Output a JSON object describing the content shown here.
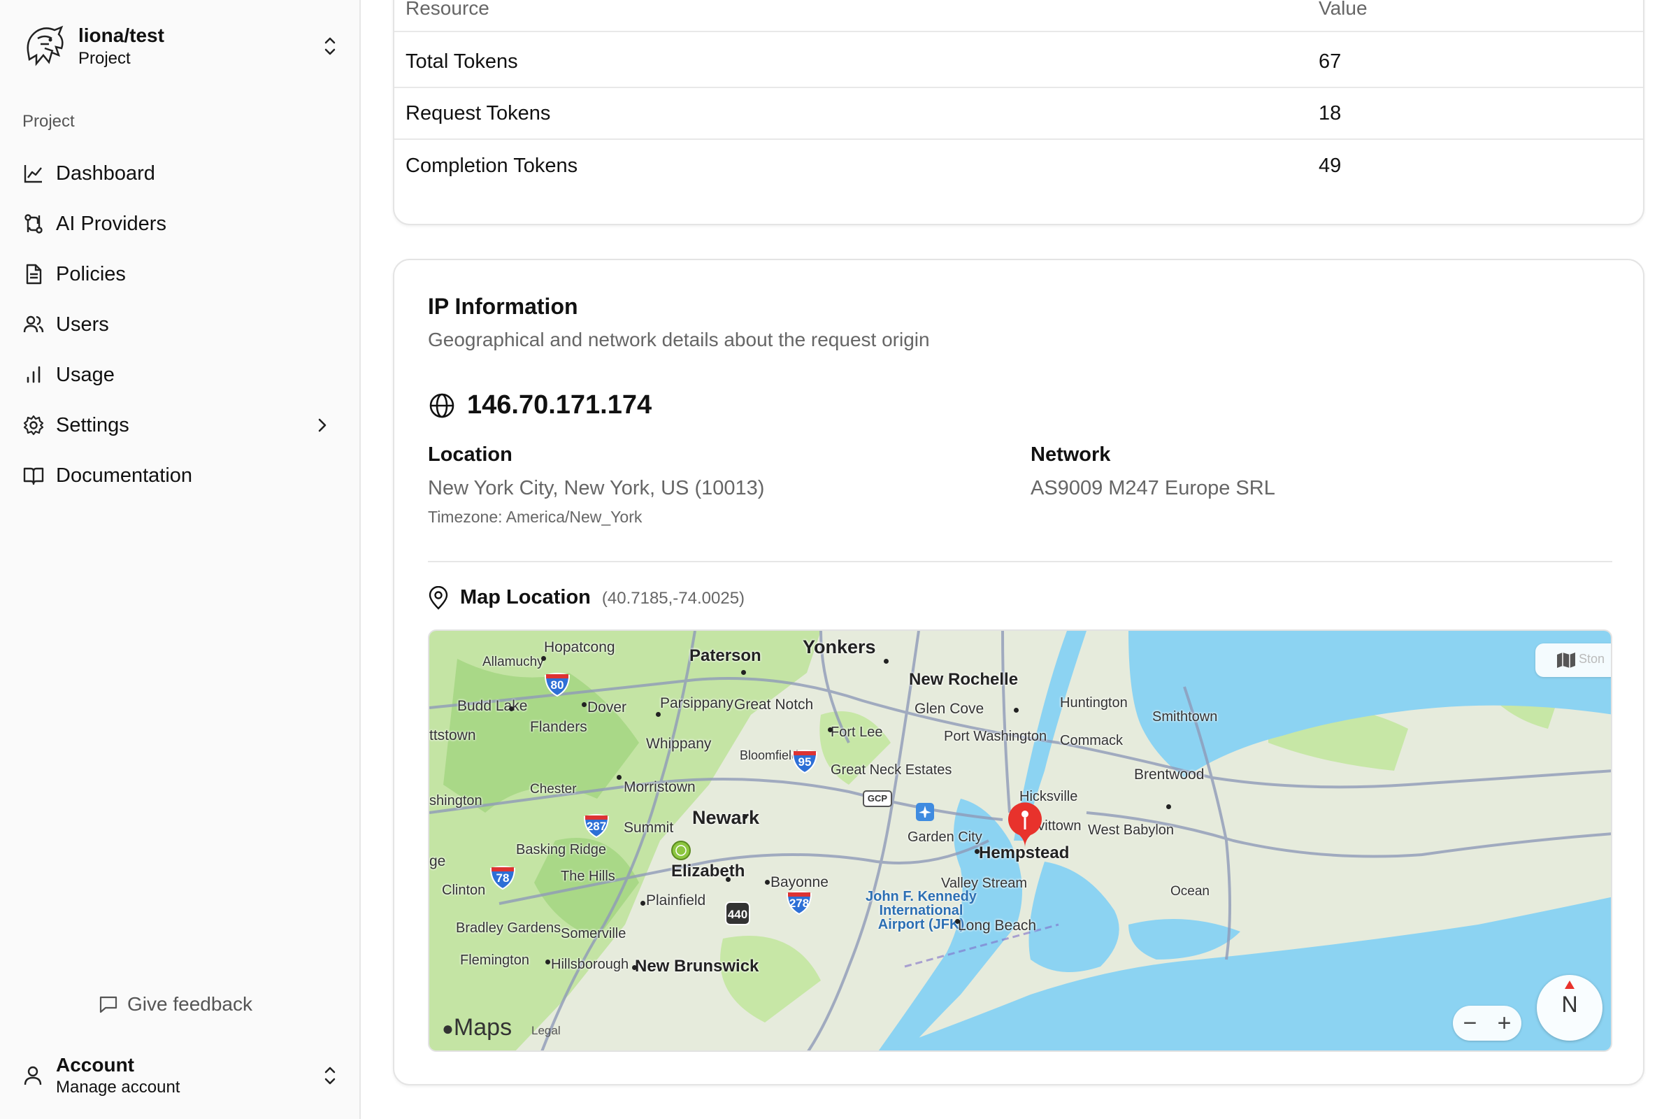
{
  "sidebar": {
    "project_name": "liona/test",
    "project_sub": "Project",
    "section_label": "Project",
    "items": [
      {
        "label": "Dashboard",
        "icon": "chart-line-icon"
      },
      {
        "label": "AI Providers",
        "icon": "providers-icon"
      },
      {
        "label": "Policies",
        "icon": "document-icon"
      },
      {
        "label": "Users",
        "icon": "users-icon"
      },
      {
        "label": "Usage",
        "icon": "bar-chart-icon"
      },
      {
        "label": "Settings",
        "icon": "gear-icon"
      },
      {
        "label": "Documentation",
        "icon": "book-open-icon"
      }
    ],
    "feedback": "Give feedback",
    "account_title": "Account",
    "account_sub": "Manage account"
  },
  "tokens_table": {
    "headers": [
      "Resource",
      "Value"
    ],
    "rows": [
      {
        "resource": "Total Tokens",
        "value": "67"
      },
      {
        "resource": "Request Tokens",
        "value": "18"
      },
      {
        "resource": "Completion Tokens",
        "value": "49"
      }
    ]
  },
  "ip_info": {
    "title": "IP Information",
    "description": "Geographical and network details about the request origin",
    "address": "146.70.171.174",
    "location_label": "Location",
    "location_value": "New York City, New York, US (10013)",
    "timezone": "Timezone: America/New_York",
    "network_label": "Network",
    "network_value": "AS9009 M247 Europe SRL",
    "map_title": "Map Location",
    "map_coords": "(40.7185,-74.0025)"
  },
  "map": {
    "places": {
      "yonkers": "Yonkers",
      "paterson": "Paterson",
      "hopatcong": "Hopatcong",
      "allamuchy": "Allamuchy",
      "new_rochelle": "New Rochelle",
      "budd_lake": "Budd Lake",
      "dover": "Dover",
      "parsippany": "Parsippany",
      "great_notch": "Great Notch",
      "glen_cove": "Glen Cove",
      "huntington": "Huntington",
      "smithtown": "Smithtown",
      "ttstown": "ttstown",
      "flanders": "Flanders",
      "fort_lee": "Fort Lee",
      "port_washington": "Port Washington",
      "commack": "Commack",
      "whippany": "Whippany",
      "bloomfield": "Bloomfield",
      "great_neck_estates": "Great Neck Estates",
      "brentwood": "Brentwood",
      "shington": "shington",
      "chester": "Chester",
      "morristown": "Morristown",
      "hicksville": "Hicksville",
      "newark": "Newark",
      "summit": "Summit",
      "levittown": "Levittown",
      "west_babylon": "West Babylon",
      "garden_city": "Garden City",
      "basking_ridge": "Basking Ridge",
      "hempstead": "Hempstead",
      "ge": "ge",
      "elizabeth": "Elizabeth",
      "the_hills": "The Hills",
      "bayonne": "Bayonne",
      "valley_stream": "Valley Stream",
      "clinton": "Clinton",
      "ocean": "Ocean",
      "plainfield": "Plainfield",
      "jfk": "John F. Kennedy\nInternational\nAirport (JFK)",
      "bradley_gardens": "Bradley Gardens",
      "somerville": "Somerville",
      "long_beach": "Long Beach",
      "flemington": "Flemington",
      "hillsborough": "Hillsborough",
      "new_brunswick": "New Brunswick"
    },
    "shields": {
      "i80": "80",
      "i95": "95",
      "i287": "287",
      "i78": "78",
      "i278": "278",
      "r440": "440"
    },
    "gcp_badge": "GCP",
    "maps_brand": "Maps",
    "legal": "Legal",
    "compass": "N",
    "zoom_out": "−",
    "zoom_in": "+",
    "map_type_peek": "Ston"
  },
  "colors": {
    "pin": "#e8322c",
    "interstate": "#2d6fd6",
    "water": "#8cd3f2",
    "land": "#e6ebdc",
    "park": "#bde39a"
  }
}
